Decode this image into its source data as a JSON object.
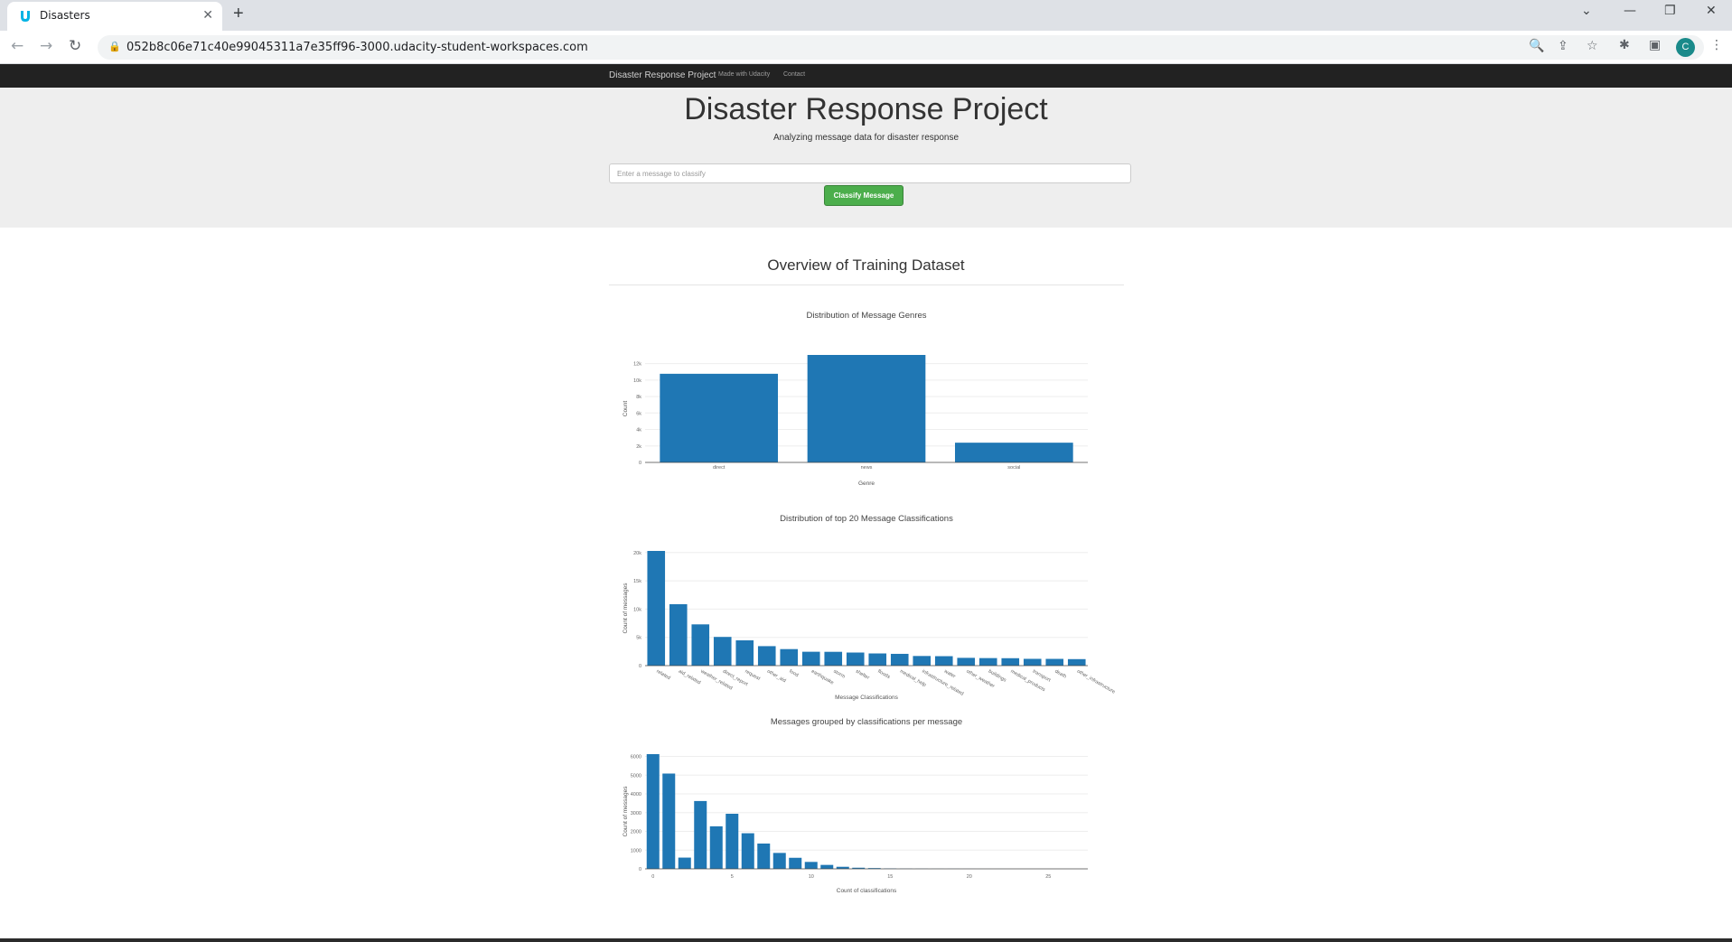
{
  "browser": {
    "tab_title": "Disasters",
    "tab_close": "✕",
    "new_tab": "+",
    "url": "052b8c06e71c40e99045311a7e35ff96-3000.udacity-student-workspaces.com",
    "avatar_letter": "C"
  },
  "navbar": {
    "brand": "Disaster Response Project",
    "links": [
      "Made with Udacity",
      "Contact"
    ]
  },
  "jumbotron": {
    "title": "Disaster Response Project",
    "subtitle": "Analyzing message data for disaster response",
    "input_placeholder": "Enter a message to classify",
    "button_label": "Classify Message"
  },
  "content": {
    "heading": "Overview of Training Dataset"
  },
  "colors": {
    "bar": "#1f77b4",
    "button": "#4cae4c",
    "navbar": "#222222"
  },
  "chart_data": [
    {
      "type": "bar",
      "title": "Distribution of Message Genres",
      "xlabel": "Genre",
      "ylabel": "Count",
      "categories": [
        "direct",
        "news",
        "social"
      ],
      "values": [
        10766,
        13054,
        2396
      ],
      "ylim": [
        0,
        13054
      ],
      "yticks": [
        0,
        2000,
        4000,
        6000,
        8000,
        10000,
        12000
      ],
      "ytick_labels": [
        "0",
        "2k",
        "4k",
        "6k",
        "8k",
        "10k",
        "12k"
      ],
      "xtick_rotate": false,
      "grid": true
    },
    {
      "type": "bar",
      "title": "Distribution of top 20 Message Classifications",
      "xlabel": "Message Classifications",
      "ylabel": "Count of messages",
      "categories": [
        "related",
        "aid_related",
        "weather_related",
        "direct_report",
        "request",
        "other_aid",
        "food",
        "earthquake",
        "storm",
        "shelter",
        "floods",
        "medical_help",
        "infrastructure_related",
        "water",
        "other_weather",
        "buildings",
        "medical_products",
        "transport",
        "death",
        "other_infrastructure"
      ],
      "values": [
        20282,
        10860,
        7297,
        5075,
        4474,
        3446,
        2923,
        2455,
        2443,
        2314,
        2155,
        2084,
        1705,
        1672,
        1376,
        1333,
        1313,
        1201,
        1194,
        1151
      ],
      "ylim": [
        0,
        20282
      ],
      "yticks": [
        0,
        5000,
        10000,
        15000,
        20000
      ],
      "ytick_labels": [
        "0",
        "5k",
        "10k",
        "15k",
        "20k"
      ],
      "xtick_rotate": true,
      "grid": true
    },
    {
      "type": "bar",
      "title": "Messages grouped by classifications per message",
      "xlabel": "Count of classifications",
      "ylabel": "Count of messages",
      "x": [
        0,
        1,
        2,
        3,
        4,
        5,
        6,
        7,
        8,
        9,
        10,
        11,
        12,
        13,
        14,
        15,
        16,
        17,
        18,
        19,
        20,
        21,
        22,
        23,
        24,
        25,
        26,
        27
      ],
      "values": [
        6122,
        5086,
        600,
        3620,
        2270,
        2940,
        1900,
        1350,
        850,
        590,
        370,
        210,
        110,
        60,
        40,
        20,
        10,
        8,
        5,
        4,
        3,
        2,
        2,
        1,
        1,
        1,
        1,
        1
      ],
      "ylim": [
        0,
        6122
      ],
      "yticks": [
        0,
        1000,
        2000,
        3000,
        4000,
        5000,
        6000
      ],
      "ytick_labels": [
        "0",
        "1000",
        "2000",
        "3000",
        "4000",
        "5000",
        "6000"
      ],
      "xticks": [
        0,
        5,
        10,
        15,
        20,
        25
      ],
      "xtick_rotate": false,
      "grid": true
    }
  ]
}
